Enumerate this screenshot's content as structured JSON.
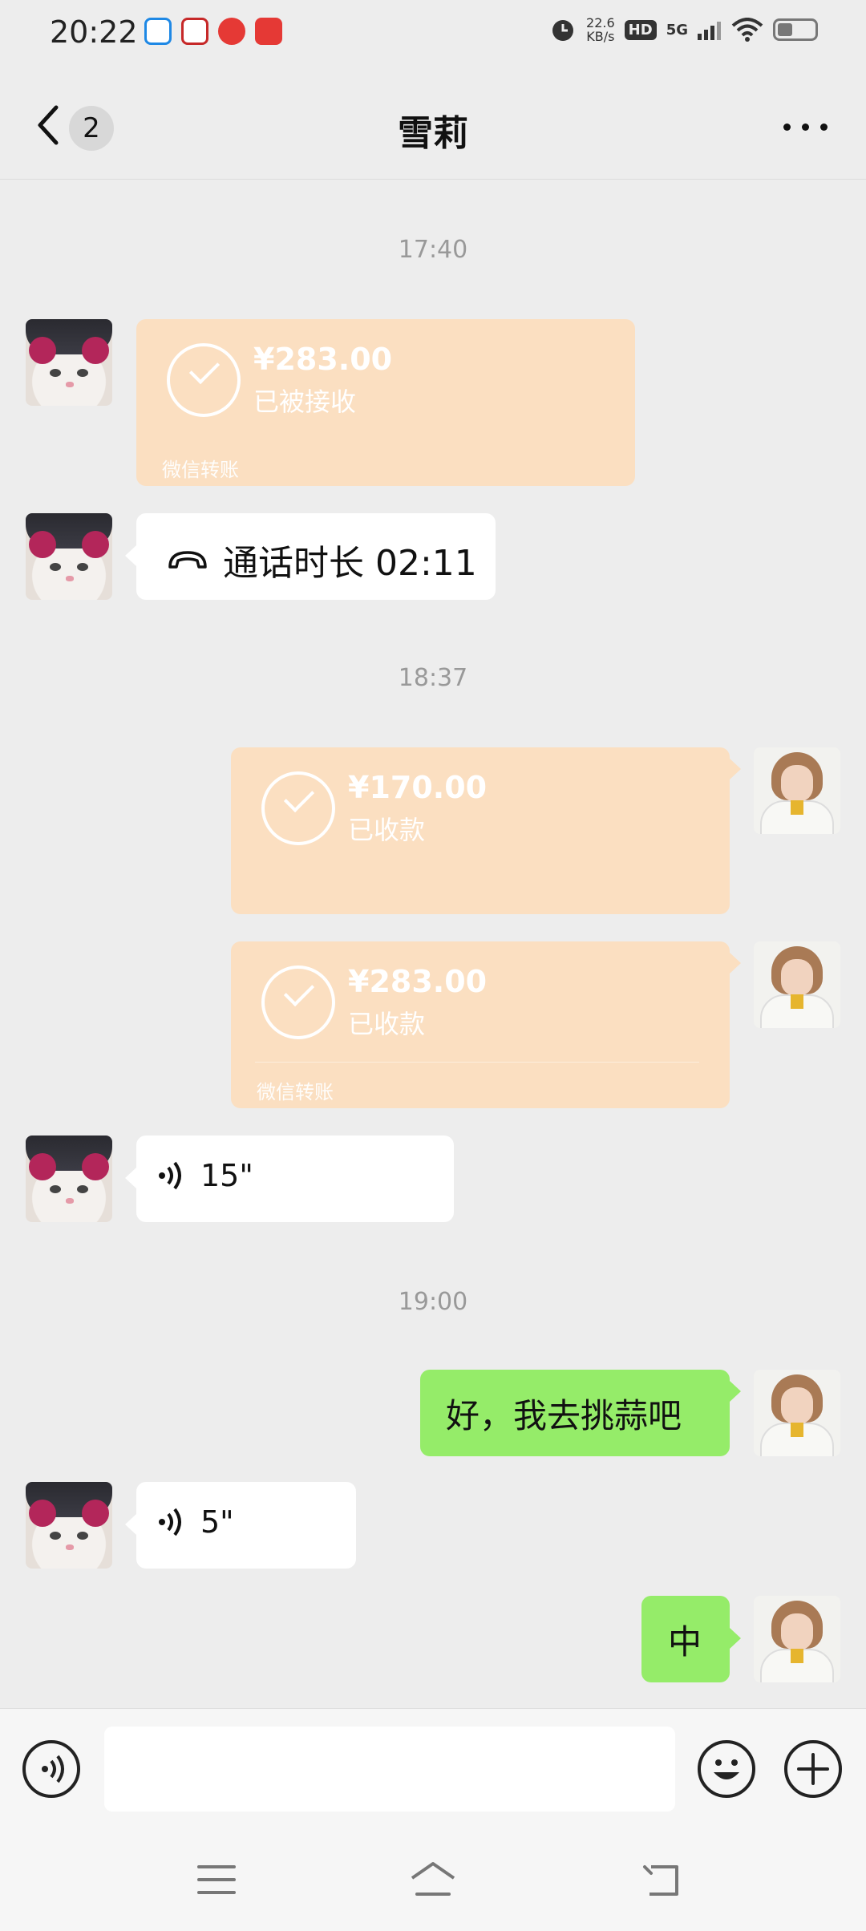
{
  "status_bar": {
    "time": "20:22",
    "network_speed_value": "22.6",
    "network_speed_unit": "KB/s",
    "hd_badge": "HD",
    "network_type": "5G",
    "battery_level": 0.35
  },
  "header": {
    "back_unread_count": "2",
    "title": "雪莉"
  },
  "messages": [
    {
      "type": "timestamp",
      "text": "17:40"
    },
    {
      "type": "transfer",
      "side": "left",
      "amount": "¥283.00",
      "status": "已被接收",
      "footer": "微信转账"
    },
    {
      "type": "call",
      "side": "left",
      "text": "通话时长 02:11"
    },
    {
      "type": "timestamp",
      "text": "18:37"
    },
    {
      "type": "transfer",
      "side": "right",
      "amount": "¥170.00",
      "status": "已收款",
      "footer": ""
    },
    {
      "type": "transfer",
      "side": "right",
      "amount": "¥283.00",
      "status": "已收款",
      "footer": "微信转账"
    },
    {
      "type": "voice",
      "side": "left",
      "duration": "15\""
    },
    {
      "type": "timestamp",
      "text": "19:00"
    },
    {
      "type": "text",
      "side": "right",
      "text": "好，我去挑蒜吧"
    },
    {
      "type": "voice",
      "side": "left",
      "duration": "5\""
    },
    {
      "type": "text",
      "side": "right",
      "text": "中"
    }
  ],
  "input_bar": {
    "text_value": "",
    "icons": [
      "voice-toggle-icon",
      "emoji-icon",
      "plus-icon"
    ]
  },
  "nav_bar": {
    "icons": [
      "menu-icon",
      "home-icon",
      "back-icon"
    ]
  },
  "colors": {
    "page_bg": "#ededed",
    "bubble_green": "#95ec69",
    "bubble_white": "#ffffff",
    "transfer_orange": "#fbdfc1"
  }
}
